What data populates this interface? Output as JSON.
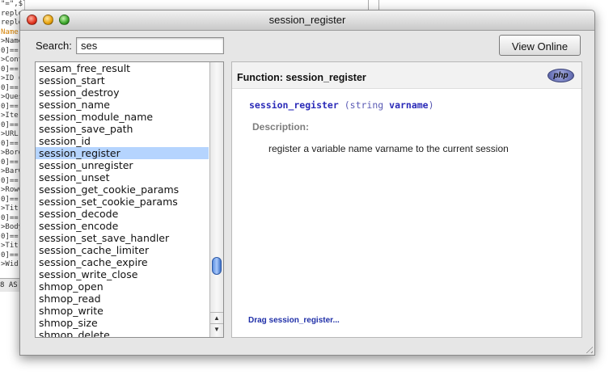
{
  "background_editor": {
    "code_lines": [
      {
        "text": "\"=\",$line);",
        "orange": false
      },
      {
        "text": "replo",
        "orange": false
      },
      {
        "text": "replo",
        "orange": false
      },
      {
        "text": "Name",
        "orange": true
      },
      {
        "text": ">Name",
        "orange": false
      },
      {
        "text": "0]==",
        "orange": false
      },
      {
        "text": ">Cont",
        "orange": false
      },
      {
        "text": "0]==",
        "orange": false
      },
      {
        "text": ">ID =",
        "orange": false
      },
      {
        "text": "0]==",
        "orange": false
      },
      {
        "text": ">Ques",
        "orange": false
      },
      {
        "text": "0]==",
        "orange": false
      },
      {
        "text": ">Iter",
        "orange": false
      },
      {
        "text": "0]==",
        "orange": false
      },
      {
        "text": ">URL",
        "orange": false
      },
      {
        "text": "0]==",
        "orange": false
      },
      {
        "text": ">Bord",
        "orange": false
      },
      {
        "text": "0]==",
        "orange": false
      },
      {
        "text": ">BarC",
        "orange": false
      },
      {
        "text": "0]==",
        "orange": false
      },
      {
        "text": ">RowC",
        "orange": false
      },
      {
        "text": "0]==",
        "orange": false
      },
      {
        "text": ">Tit",
        "orange": false
      },
      {
        "text": "0]==",
        "orange": false
      },
      {
        "text": ">Body",
        "orange": false
      },
      {
        "text": "0]==",
        "orange": false
      },
      {
        "text": ">Tit",
        "orange": false
      },
      {
        "text": "0]==",
        "orange": false
      },
      {
        "text": ">Wid",
        "orange": false
      }
    ],
    "status": "8 AS"
  },
  "window": {
    "title": "session_register"
  },
  "search": {
    "label": "Search:",
    "value": "ses"
  },
  "view_online_label": "View Online",
  "functions": {
    "items": [
      "sesam_free_result",
      "session_start",
      "session_destroy",
      "session_name",
      "session_module_name",
      "session_save_path",
      "session_id",
      "session_register",
      "session_unregister",
      "session_unset",
      "session_get_cookie_params",
      "session_set_cookie_params",
      "session_decode",
      "session_encode",
      "session_set_save_handler",
      "session_cache_limiter",
      "session_cache_expire",
      "session_write_close",
      "shmop_open",
      "shmop_read",
      "shmop_write",
      "shmop_size",
      "shmop_delete"
    ],
    "selected": "session_register"
  },
  "detail": {
    "title": "Function: session_register",
    "php_logo_text": "php",
    "signature": {
      "name": "session_register",
      "open": "(",
      "type": "string",
      "arg": "varname",
      "close": ")"
    },
    "description_label": "Description:",
    "description": "register a variable name varname to the current session",
    "drag_link": "Drag session_register..."
  },
  "colors": {
    "selection": "#b5d4fe",
    "signature_blue": "#2a2ab8",
    "link_blue": "#1f2fa8",
    "window_bg": "#e6e6e6"
  },
  "icons": {
    "close": "close-icon",
    "minimize": "minimize-icon",
    "zoom": "zoom-icon",
    "resize": "resize-grip-icon",
    "scroll_up": "arrow-up-icon",
    "scroll_down": "arrow-down-icon"
  }
}
